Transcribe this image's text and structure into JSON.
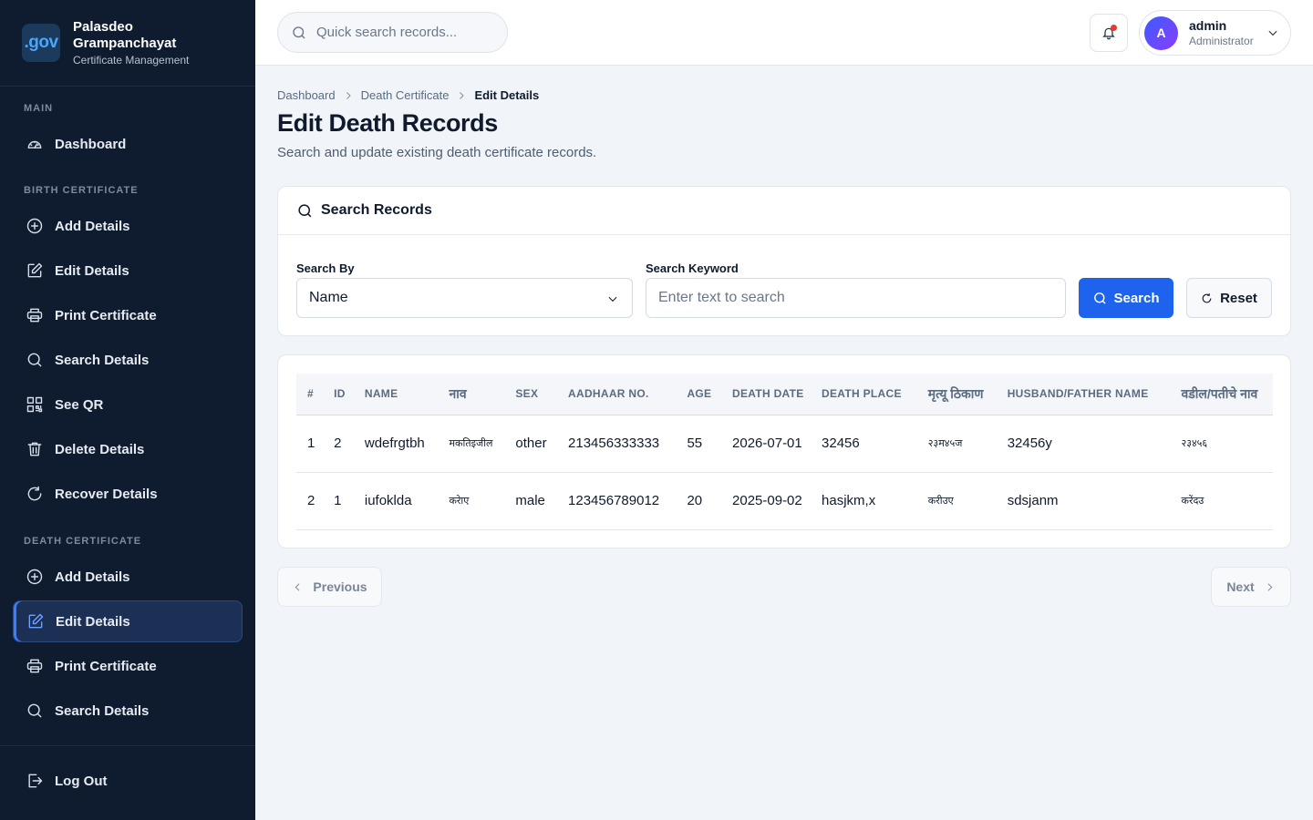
{
  "brand": {
    "logo_text": ".gov",
    "name": "Palasdeo Grampanchayat",
    "subtitle": "Certificate Management"
  },
  "sidebar": {
    "sections": [
      {
        "label": "MAIN",
        "items": [
          {
            "label": "Dashboard",
            "icon": "gauge-icon"
          }
        ]
      },
      {
        "label": "BIRTH CERTIFICATE",
        "items": [
          {
            "label": "Add Details",
            "icon": "plus-circle-icon"
          },
          {
            "label": "Edit Details",
            "icon": "edit-icon"
          },
          {
            "label": "Print Certificate",
            "icon": "printer-icon"
          },
          {
            "label": "Search Details",
            "icon": "search-icon"
          },
          {
            "label": "See QR",
            "icon": "qr-icon"
          },
          {
            "label": "Delete Details",
            "icon": "trash-icon"
          },
          {
            "label": "Recover Details",
            "icon": "refresh-icon"
          }
        ]
      },
      {
        "label": "DEATH CERTIFICATE",
        "items": [
          {
            "label": "Add Details",
            "icon": "plus-circle-icon"
          },
          {
            "label": "Edit Details",
            "icon": "edit-icon",
            "active": true
          },
          {
            "label": "Print Certificate",
            "icon": "printer-icon"
          },
          {
            "label": "Search Details",
            "icon": "search-icon"
          }
        ]
      }
    ],
    "logout_label": "Log Out"
  },
  "topbar": {
    "search_placeholder": "Quick search records...",
    "notification_dot_color": "#e53935",
    "user": {
      "initial": "A",
      "name": "admin",
      "role": "Administrator"
    }
  },
  "breadcrumb": [
    "Dashboard",
    "Death Certificate",
    "Edit Details"
  ],
  "page": {
    "title": "Edit Death Records",
    "subtitle": "Search and update existing death certificate records."
  },
  "search_card": {
    "title": "Search Records",
    "search_by_label": "Search By",
    "search_by_value": "Name",
    "keyword_label": "Search Keyword",
    "keyword_placeholder": "Enter text to search",
    "search_button": "Search",
    "reset_button": "Reset"
  },
  "table": {
    "columns": [
      "#",
      "ID",
      "NAME",
      "नाव",
      "SEX",
      "AADHAAR NO.",
      "AGE",
      "DEATH DATE",
      "DEATH PLACE",
      "मृत्यू ठिकाण",
      "HUSBAND/FATHER NAME",
      "वडील/पतीचे नाव"
    ],
    "rows": [
      {
        "num": "1",
        "id": "2",
        "name": "wdefrgtbh",
        "name_mr": "मकतिइजील",
        "sex": "other",
        "aadhaar": "213456333333",
        "age": "55",
        "death_date": "2026-07-01",
        "death_place": "32456",
        "death_place_mr": "२३म४५ज",
        "father_name": "32456y",
        "father_name_mr": "२३४५६"
      },
      {
        "num": "2",
        "id": "1",
        "name": "iufoklda",
        "name_mr": "करेाए",
        "sex": "male",
        "aadhaar": "123456789012",
        "age": "20",
        "death_date": "2025-09-02",
        "death_place": "hasjkm,x",
        "death_place_mr": "करीउए",
        "father_name": "sdsjanm",
        "father_name_mr": "करेंदउ"
      }
    ]
  },
  "pagination": {
    "previous": "Previous",
    "next": "Next"
  },
  "colors": {
    "sidebar_bg": "#0f1b2e",
    "accent": "#1d63ed",
    "active_bg": "#1c2f55"
  }
}
